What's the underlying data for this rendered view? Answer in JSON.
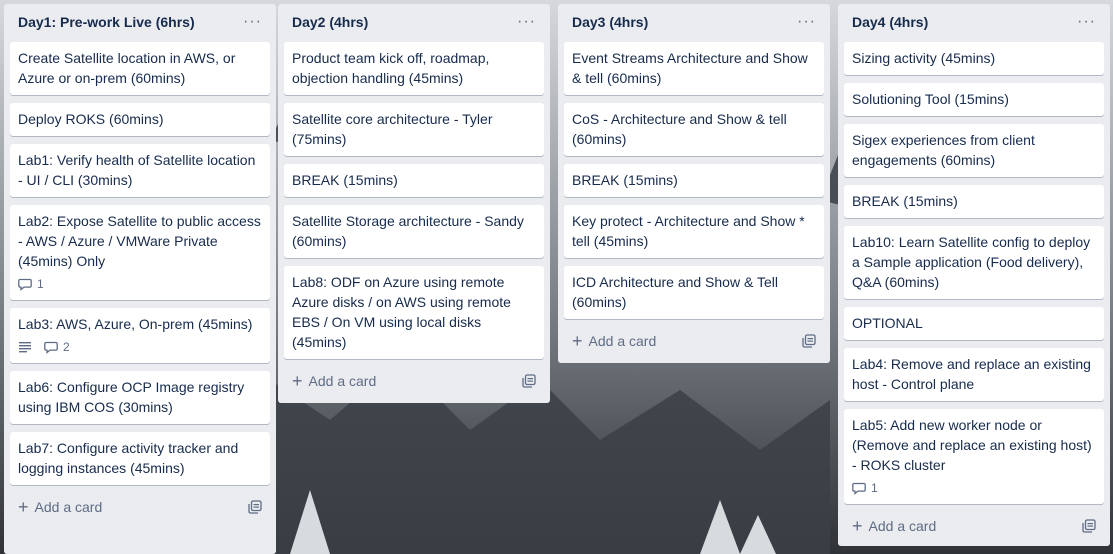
{
  "lists": [
    {
      "title": "Day1: Pre-work Live (6hrs)",
      "menu": "···",
      "cards": [
        {
          "text": "Create Satellite location in AWS, or Azure or on-prem (60mins)"
        },
        {
          "text": "Deploy ROKS (60mins)"
        },
        {
          "text": "Lab1: Verify health of Satellite location - UI / CLI (30mins)"
        },
        {
          "text": "Lab2: Expose Satellite to public access - AWS / Azure / VMWare Private (45mins) Only",
          "comments": "1"
        },
        {
          "text": "Lab3: AWS, Azure, On-prem (45mins)",
          "comments": "2",
          "description": true
        },
        {
          "text": "Lab6: Configure OCP Image registry using IBM COS (30mins)"
        },
        {
          "text": "Lab7: Configure activity tracker and logging instances (45mins)"
        }
      ],
      "add_label": "Add a card"
    },
    {
      "title": "Day2 (4hrs)",
      "menu": "···",
      "cards": [
        {
          "text": "Product team kick off, roadmap, objection handling (45mins)"
        },
        {
          "text": "Satellite core architecture - Tyler (75mins)"
        },
        {
          "text": "BREAK (15mins)"
        },
        {
          "text": "Satellite Storage architecture - Sandy (60mins)"
        },
        {
          "text": "Lab8: ODF on Azure using remote Azure disks / on AWS using remote EBS / On VM using local disks (45mins)"
        }
      ],
      "add_label": "Add a card"
    },
    {
      "title": "Day3 (4hrs)",
      "menu": "···",
      "cards": [
        {
          "text": "Event Streams Architecture and Show & tell (60mins)"
        },
        {
          "text": "CoS - Architecture and Show & tell (60mins)"
        },
        {
          "text": "BREAK (15mins)"
        },
        {
          "text": "Key protect - Architecture and Show * tell (45mins)"
        },
        {
          "text": "ICD Architecture and Show & Tell (60mins)"
        }
      ],
      "add_label": "Add a card"
    },
    {
      "title": "Day4 (4hrs)",
      "menu": "···",
      "cards": [
        {
          "text": "Sizing activity (45mins)"
        },
        {
          "text": "Solutioning Tool (15mins)"
        },
        {
          "text": "Sigex experiences from client engagements (60mins)"
        },
        {
          "text": "BREAK (15mins)"
        },
        {
          "text": "Lab10: Learn Satellite config to deploy a Sample application (Food delivery), Q&A (60mins)"
        },
        {
          "text": "OPTIONAL"
        },
        {
          "text": "Lab4: Remove and replace an existing host - Control plane"
        },
        {
          "text": "Lab5: Add new worker node or (Remove and replace an existing host) - ROKS cluster",
          "comments": "1"
        }
      ],
      "add_label": "Add a card"
    }
  ],
  "icons": {
    "menu": "more-horizontal-icon",
    "comment": "comment-icon",
    "description": "description-icon",
    "add": "plus-icon",
    "template": "card-template-icon"
  }
}
